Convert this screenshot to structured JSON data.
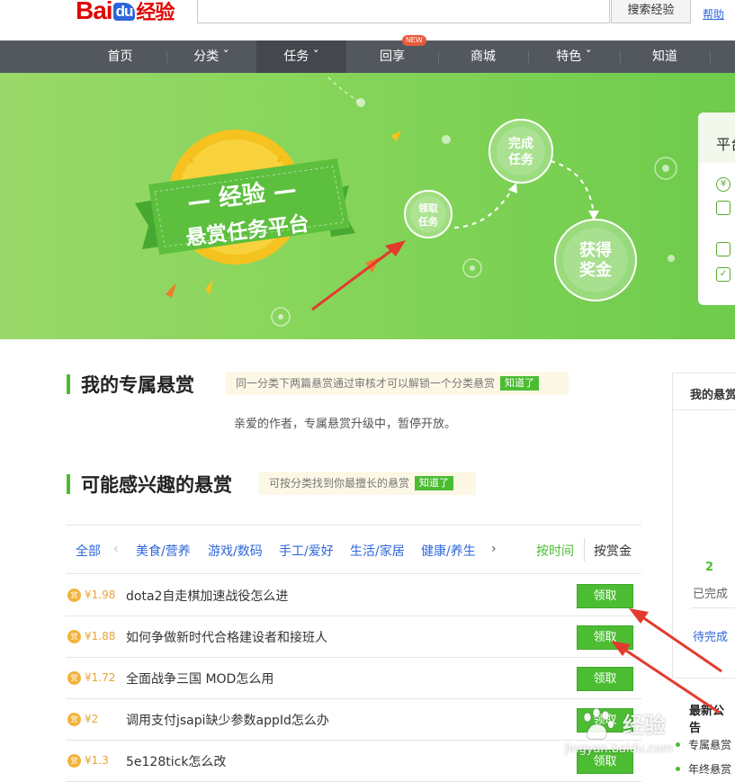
{
  "header": {
    "logo": {
      "bai": "Bai",
      "du": "du",
      "jingyan": "经验"
    },
    "search_placeholder": "",
    "search_button": "搜索经验",
    "help_link": "帮助"
  },
  "nav": {
    "items": [
      {
        "label": "首页"
      },
      {
        "label": "分类 ˇ"
      },
      {
        "label": "任务 ˇ"
      },
      {
        "label": "回享"
      },
      {
        "label": "商城"
      },
      {
        "label": "特色 ˇ"
      },
      {
        "label": "知道"
      }
    ],
    "new_badge": "NEW"
  },
  "banner": {
    "title_line1": "— 经验 —",
    "title_line2": "悬赏任务平台",
    "step1": "领取\n任务",
    "step2": "完成\n任务",
    "step3": "获得\n奖金",
    "side_panel_title": "平台"
  },
  "exclusive": {
    "title": "我的专属悬赏",
    "tip": "同一分类下两篇悬赏通过审核才可以解锁一个分类悬赏",
    "got_it": "知道了",
    "notice": "亲爱的作者，专属悬赏升级中，暂停开放。"
  },
  "interest": {
    "title": "可能感兴趣的悬赏",
    "tip": "可按分类找到你最擅长的悬赏",
    "got_it": "知道了"
  },
  "filters": {
    "all": "全部",
    "prev": "‹",
    "categories": [
      "美食/营养",
      "游戏/数码",
      "手工/爱好",
      "生活/家居",
      "健康/养生"
    ],
    "next": "›",
    "sort_time": "按时间",
    "sort_reward": "按赏金"
  },
  "tasks": [
    {
      "coin": "赏",
      "reward": "¥1.98",
      "title": "dota2自走棋加速战役怎么进",
      "button": "领取"
    },
    {
      "coin": "赏",
      "reward": "¥1.88",
      "title": "如何争做新时代合格建设者和接班人",
      "button": "领取"
    },
    {
      "coin": "赏",
      "reward": "¥1.72",
      "title": "全面战争三国 MOD怎么用",
      "button": "领取"
    },
    {
      "coin": "赏",
      "reward": "¥2",
      "title": "调用支付jsapi缺少参数appId怎么办",
      "button": "领取"
    },
    {
      "coin": "赏",
      "reward": "¥1.3",
      "title": "5e128tick怎么改",
      "button": "领取"
    }
  ],
  "my_rewards": {
    "title": "我的悬赏",
    "done_count": "2",
    "done_label": "已完成",
    "pending_label": "待完成"
  },
  "announcements": {
    "title": "最新公告",
    "items": [
      "专属悬赏",
      "年终悬赏"
    ]
  },
  "watermark": {
    "main": "经验",
    "url": "jingyan.baidu.com"
  },
  "colors": {
    "accent_green": "#4cbd33",
    "link_blue": "#2d66d9",
    "nav_bg": "#53585f",
    "arrow_red": "#e23b2e"
  }
}
